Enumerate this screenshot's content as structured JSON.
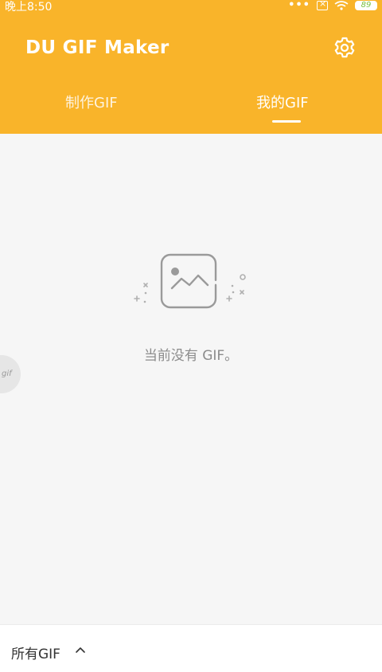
{
  "status": {
    "time": "晚上8:50",
    "dots": "•••",
    "battery": "89"
  },
  "header": {
    "title": "DU GIF Maker",
    "settings_icon": "gear-icon",
    "tabs": [
      {
        "label": "制作GIF",
        "active": false
      },
      {
        "label": "我的GIF",
        "active": true
      }
    ]
  },
  "main": {
    "empty_icon": "image-placeholder-icon",
    "empty_message": "当前没有 GIF。",
    "floating_badge": "gif"
  },
  "footer": {
    "filter_label": "所有GIF",
    "filter_icon": "chevron-up-icon"
  },
  "colors": {
    "accent": "#f9b42a",
    "background": "#f6f6f6",
    "muted_text": "#8c8c8c"
  }
}
